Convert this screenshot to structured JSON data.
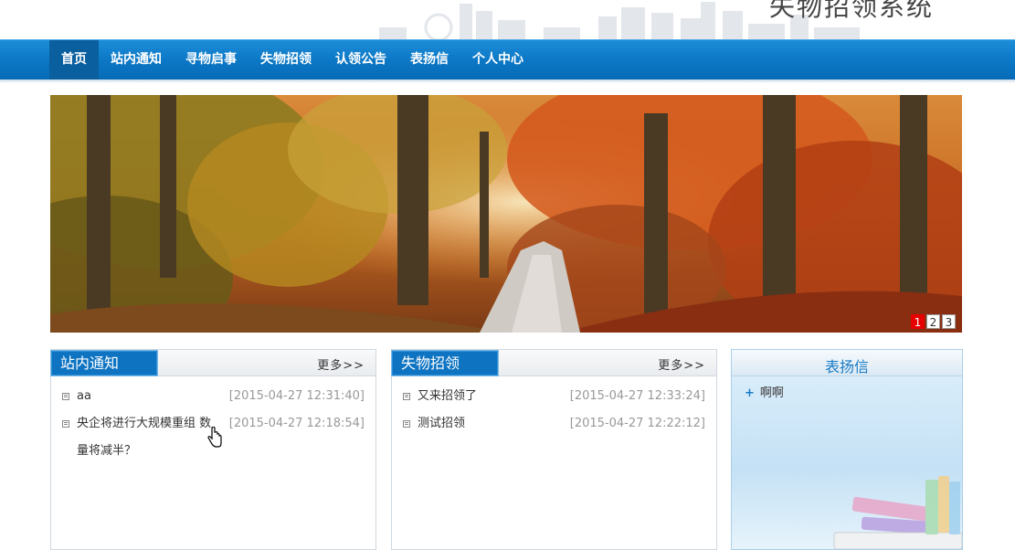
{
  "site": {
    "title": "失物招领系统"
  },
  "nav": {
    "items": [
      {
        "label": "首页",
        "active": true
      },
      {
        "label": "站内通知",
        "active": false
      },
      {
        "label": "寻物启事",
        "active": false
      },
      {
        "label": "失物招领",
        "active": false
      },
      {
        "label": "认领公告",
        "active": false
      },
      {
        "label": "表扬信",
        "active": false
      },
      {
        "label": "个人中心",
        "active": false
      }
    ]
  },
  "banner": {
    "slides": [
      "1",
      "2",
      "3"
    ],
    "current": "1"
  },
  "notices": {
    "title": "站内通知",
    "more": "更多>>",
    "items": [
      {
        "title": "aa",
        "date": "[2015-04-27 12:31:40]"
      },
      {
        "title": "央企将进行大规模重组 数",
        "title_cont": "量将减半？",
        "date": "[2015-04-27 12:18:54]"
      }
    ]
  },
  "lostfound": {
    "title": "失物招领",
    "more": "更多>>",
    "items": [
      {
        "title": "又来招领了",
        "date": "[2015-04-27 12:33:24]"
      },
      {
        "title": "测试招领",
        "date": "[2015-04-27 12:22:12]"
      }
    ]
  },
  "praise": {
    "title": "表扬信",
    "items": [
      {
        "label": "啊啊"
      }
    ]
  },
  "colors": {
    "nav_blue": "#0c78c6",
    "accent_red": "#e60000",
    "date_gray": "#999999"
  }
}
